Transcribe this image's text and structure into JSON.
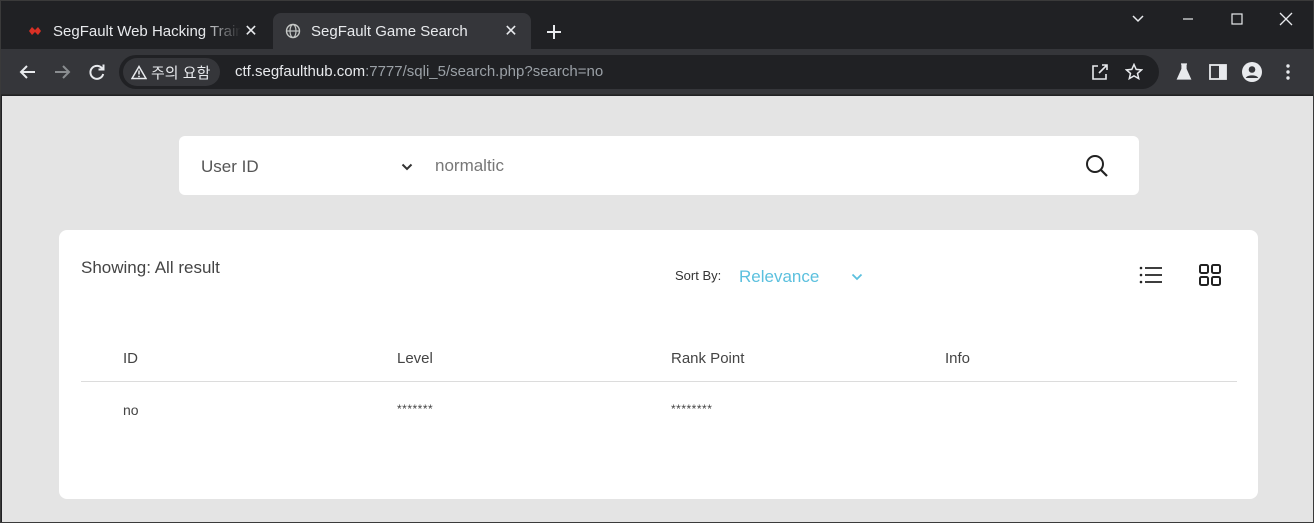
{
  "browser": {
    "tabs": [
      {
        "title": "SegFault Web Hacking Training",
        "active": false,
        "favicon": "segfault-logo-icon"
      },
      {
        "title": "SegFault Game Search",
        "active": true,
        "favicon": "globe-icon"
      }
    ],
    "address_bar": {
      "security_label": "주의 요함",
      "url_host": "ctf.segfaulthub.com",
      "url_rest": ":7777/sqli_5/search.php?search=no"
    }
  },
  "search": {
    "field_select": "User ID",
    "query": "normaltic"
  },
  "results": {
    "showing_label": "Showing: All result",
    "sort_by_label": "Sort By:",
    "sort_by_value": "Relevance",
    "columns": [
      "ID",
      "Level",
      "Rank Point",
      "Info"
    ],
    "rows": [
      {
        "id": "no",
        "level": "*******",
        "rank_point": "********",
        "info": ""
      }
    ]
  },
  "colors": {
    "accent": "#5bc0de",
    "page_background": "#e4e4e4",
    "browser_chrome": "#35363a"
  }
}
